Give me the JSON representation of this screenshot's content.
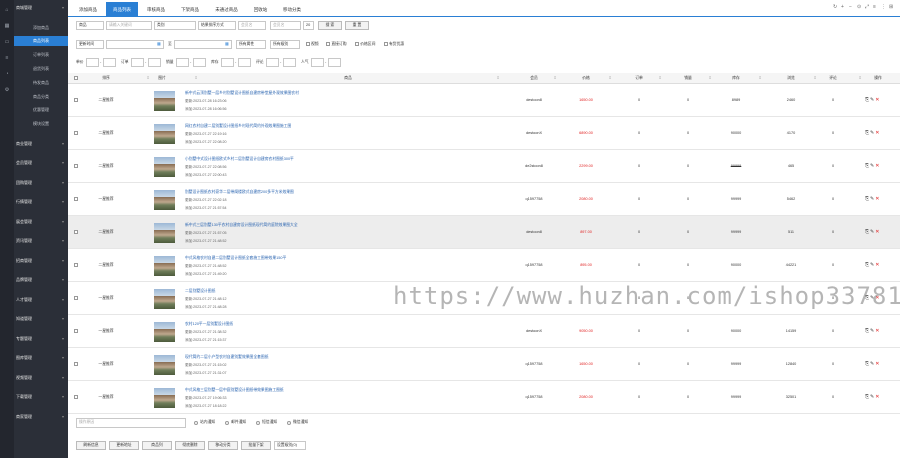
{
  "sidebar": {
    "rail_icons": [
      "home-icon",
      "grid-icon",
      "chat-icon",
      "list-icon",
      "bell-icon",
      "setting-icon"
    ],
    "items": [
      {
        "label": "商城管理",
        "type": "group"
      },
      {
        "label": "添加商品",
        "type": "sub"
      },
      {
        "label": "商品列表",
        "type": "sub",
        "active": true
      },
      {
        "label": "订单列表",
        "type": "sub"
      },
      {
        "label": "退货列表",
        "type": "sub"
      },
      {
        "label": "待发商品",
        "type": "sub"
      },
      {
        "label": "商品分类",
        "type": "sub"
      },
      {
        "label": "优惠管理",
        "type": "sub"
      },
      {
        "label": "模块设置",
        "type": "sub"
      },
      {
        "label": "商业管理",
        "type": "group"
      },
      {
        "label": "会员管理",
        "type": "group"
      },
      {
        "label": "团购管理",
        "type": "group"
      },
      {
        "label": "行情管理",
        "type": "group"
      },
      {
        "label": "展会管理",
        "type": "group"
      },
      {
        "label": "资讯管理",
        "type": "group"
      },
      {
        "label": "招商管理",
        "type": "group"
      },
      {
        "label": "品牌管理",
        "type": "group"
      },
      {
        "label": "人才管理",
        "type": "group"
      },
      {
        "label": "知道管理",
        "type": "group"
      },
      {
        "label": "专题管理",
        "type": "group"
      },
      {
        "label": "图库管理",
        "type": "group"
      },
      {
        "label": "视频管理",
        "type": "group"
      },
      {
        "label": "下载管理",
        "type": "group"
      },
      {
        "label": "商家管理",
        "type": "group"
      }
    ]
  },
  "tabs": [
    "添加商品",
    "商品列表",
    "审核商品",
    "下架商品",
    "未通过商品",
    "回收站",
    "移动分类"
  ],
  "filters": {
    "field_select": "商品",
    "keyword_placeholder": "请输入关键词",
    "category_select": "类别",
    "sort_select": "结果排序方式",
    "member_placeholder": "会员名",
    "page_size": "20",
    "search_button": "搜 索",
    "reset_button": "重 置",
    "date_select": "更新时间",
    "date_to": "至",
    "attr_select": "所有属性",
    "level_select": "所有级别",
    "checks": [
      "视频",
      "直接订购",
      "价格区间",
      "有货优惠"
    ],
    "range_labels": [
      "单价",
      "订单",
      "销量",
      "库存",
      "评论",
      "人气"
    ],
    "range_sep": "-"
  },
  "table": {
    "headers": [
      "排序",
      "图片",
      "商品",
      "会员",
      "价格",
      "订单",
      "销量",
      "库存",
      "浏览",
      "评论",
      "操作"
    ],
    "rows": [
      {
        "level": "二星推荐",
        "title": "新中式云顶别墅一层乡村别墅设计图纸自建房带堂屋外观效果图农村",
        "updated": "更新:2023-07-28 16:23:06",
        "added": "添加:2023-07-28 16:06:56",
        "member": "destoon8",
        "price": "1650.00",
        "orders": "0",
        "sales": "0",
        "stock": "8989",
        "views": "2460",
        "comments": "0"
      },
      {
        "level": "二星推荐",
        "title": "网红农村自建二层别墅设计图纸乡村现代简约外观效果图施工图",
        "updated": "更新:2023-07-27 22:19:16",
        "added": "添加:2023-07-27 22:08:20",
        "member": "destoonX",
        "price": "6890.00",
        "orders": "0",
        "sales": "0",
        "stock": "90000",
        "views": "4170",
        "comments": "0"
      },
      {
        "level": "二星推荐",
        "title": "小别墅中式设计图纸欧式乡村二层别墅设计自建房农村图纸300平",
        "updated": "更新:2023-07-27 22:08:56",
        "added": "添加:2023-07-27 22:00:43",
        "member": "de2stoon8",
        "price": "2299.00",
        "orders": "0",
        "sales": "0",
        "stock": "99999",
        "views": "465",
        "comments": "0"
      },
      {
        "level": "一星推荐",
        "title": "别墅设计图纸农村豪华二层带阁楼欧式自建房200多平方米效果图",
        "updated": "更新:2023-07-27 22:02:18",
        "added": "添加:2023-07-27 21:57:54",
        "member": "q1597758",
        "price": "2080.00",
        "orders": "0",
        "sales": "0",
        "stock": "99999",
        "views": "5462",
        "comments": "0"
      },
      {
        "level": "二星推荐",
        "title": "新中式三层别墅130平农村自建房设计图纸现代简约庭院效果图大全",
        "updated": "更新:2023-07-27 21:57:05",
        "added": "添加:2023-07-27 21:48:52",
        "member": "destoon8",
        "price": "897.00",
        "orders": "0",
        "sales": "0",
        "stock": "99999",
        "views": "511",
        "comments": "0"
      },
      {
        "level": "二星推荐",
        "title": "中式风格农村自建二层别墅设计图纸全套施工图带效果150平",
        "updated": "更新:2023-07-27 21:48:52",
        "added": "添加:2023-07-27 21:49:20",
        "member": "q1597758",
        "price": "895.00",
        "orders": "0",
        "sales": "0",
        "stock": "90000",
        "views": "44221",
        "comments": "0"
      },
      {
        "level": "一星推荐",
        "title": "二层别墅设计图纸",
        "updated": "更新:2023-07-27 21:48:12",
        "added": "添加:2023-07-27 21:48:28",
        "member": "",
        "price": "",
        "orders": "0",
        "sales": "0",
        "stock": "",
        "views": "",
        "comments": "0"
      },
      {
        "level": "一星推荐",
        "title": "农村120平一层别墅设计图纸",
        "updated": "更新:2023-07-27 21:38:32",
        "added": "添加:2023-07-27 21:15:37",
        "member": "destoonX",
        "price": "9050.00",
        "orders": "0",
        "sales": "0",
        "stock": "90000",
        "views": "14159",
        "comments": "0"
      },
      {
        "level": "一星推荐",
        "title": "现代简约二层小户型农村自建别墅效果图全套图纸",
        "updated": "更新:2023-07-27 21:15:02",
        "added": "添加:2023-07-27 21:31:07",
        "member": "q1597758",
        "price": "1650.00",
        "orders": "0",
        "sales": "0",
        "stock": "99999",
        "views": "12840",
        "comments": "0"
      },
      {
        "level": "一星推荐",
        "title": "中式风格三层别墅一层中庭别墅设计图纸带效果图施工图纸",
        "updated": "更新:2023-07-27 19:06:33",
        "added": "添加:2023-07-27 18:18:22",
        "member": "q1597758",
        "price": "2080.00",
        "orders": "0",
        "sales": "0",
        "stock": "99999",
        "views": "32501",
        "comments": "0"
      }
    ]
  },
  "footer": {
    "remark_placeholder": "操作原因",
    "radios": [
      "站内通知",
      "邮件通知",
      "短信通知",
      "微信通知"
    ],
    "buttons": [
      "刷新信息",
      "更新地址",
      "商品列",
      "彻底删除",
      "移动分类",
      "批量下架"
    ],
    "level_select": "设置级别(0)"
  },
  "watermark": "https://www.huzhan.com/ishop33781",
  "colors": {
    "accent": "#2a7fd4",
    "sidebar": "#2b2f38",
    "price": "#e02020"
  }
}
